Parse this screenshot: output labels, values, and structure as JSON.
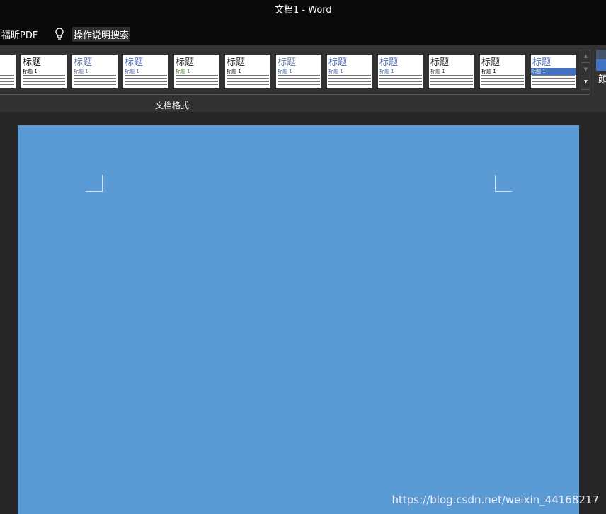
{
  "window": {
    "title": "文档1  -  Word"
  },
  "tellbar": {
    "pdf_tab": "福昕PDF",
    "search_label": "操作说明搜索",
    "icon": "lightbulb-icon"
  },
  "ribbon": {
    "group_label": "文档格式",
    "partial_label": "颜",
    "styles": [
      {
        "title": "",
        "heading": ""
      },
      {
        "title": "标题",
        "heading": "标题 1",
        "title_color": "#000000",
        "heading_color": "#000000"
      },
      {
        "title": "标题",
        "heading": "标题 1",
        "title_color": "#5a6e9a",
        "heading_color": "#5a6e9a"
      },
      {
        "title": "标题",
        "heading": "标题 1",
        "title_color": "#4a69b0",
        "heading_color": "#4a69b0"
      },
      {
        "title": "标题",
        "heading": "标题 1",
        "title_color": "#222222",
        "heading_color": "#5a8a3a"
      },
      {
        "title": "标题",
        "heading": "标题 1",
        "title_color": "#222222",
        "heading_color": "#222222"
      },
      {
        "title": "标题",
        "heading": "标题 1",
        "title_color": "#6a7a9a",
        "heading_color": "#4a69b0"
      },
      {
        "title": "标题",
        "heading": "标题 1",
        "title_color": "#4a69b0",
        "heading_color": "#4a69b0"
      },
      {
        "title": "标题",
        "heading": "标题 1",
        "title_color": "#4a69b0",
        "heading_color": "#4a69b0"
      },
      {
        "title": "标题",
        "heading": "标题 1",
        "title_color": "#222222",
        "heading_color": "#444444"
      },
      {
        "title": "标题",
        "heading": "标题 1",
        "title_color": "#222222",
        "heading_color": "#000000"
      },
      {
        "title": "标题",
        "heading": "标题 1",
        "title_color": "#4a69b0",
        "heading_color": "#ffffff"
      }
    ]
  },
  "document": {
    "page_color": "#5b9bd5"
  },
  "watermark": "https://blog.csdn.net/weixin_44168217"
}
